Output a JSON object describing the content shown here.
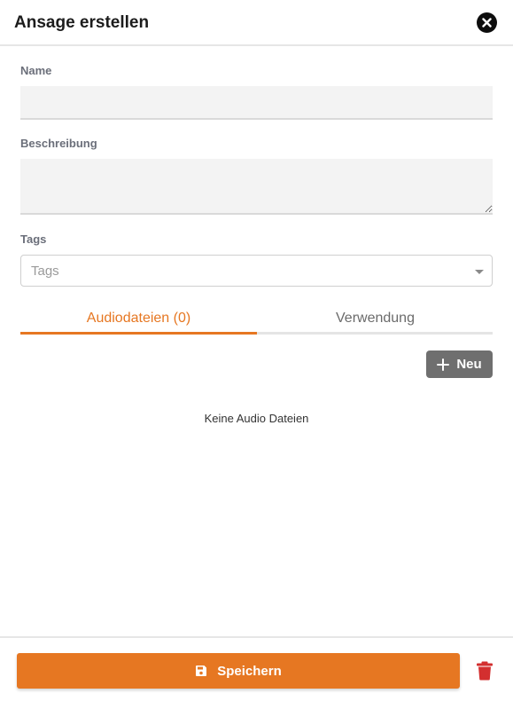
{
  "dialog": {
    "title": "Ansage erstellen",
    "close_icon": "close-icon"
  },
  "form": {
    "name": {
      "label": "Name",
      "value": ""
    },
    "description": {
      "label": "Beschreibung",
      "value": ""
    },
    "tags": {
      "label": "Tags",
      "placeholder": "Tags"
    }
  },
  "tabs": [
    {
      "label": "Audiodateien (0)",
      "active": true
    },
    {
      "label": "Verwendung",
      "active": false
    }
  ],
  "audio": {
    "new_button_label": "Neu",
    "empty_text": "Keine Audio Dateien"
  },
  "footer": {
    "save_label": "Speichern",
    "save_icon": "save-icon",
    "delete_icon": "trash-icon"
  },
  "colors": {
    "accent": "#e67722",
    "delete": "#d32f2f",
    "neutral_button": "#6f6f6f"
  }
}
